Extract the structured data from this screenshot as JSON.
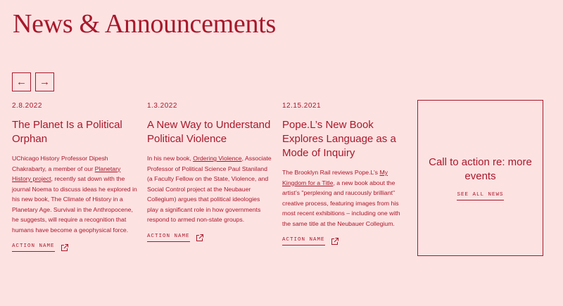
{
  "header": {
    "title": "News & Announcements"
  },
  "nav": {
    "prev": "←",
    "next": "→"
  },
  "cards": [
    {
      "date": "2.8.2022",
      "title": "The Planet Is a Political Orphan",
      "body_1": "UChicago History Professor Dipesh Chakrabarty, a member of our ",
      "link": "Planetary History project",
      "body_2": ", recently sat down with the journal Noema to discuss ideas he explored in his new book, The Climate of History in a Planetary Age. Survival in the Anthropocene, he suggests, will require a recognition that humans have become a geophysical force.",
      "action": "ACTION NAME"
    },
    {
      "date": "1.3.2022",
      "title": "A New Way to Understand Political Violence",
      "body_1": "In his new book, ",
      "link": "Ordering Violence",
      "body_2": ", Associate Professor of Political Science Paul Staniland (a Faculty Fellow on the State, Violence, and Social Control project at the Neubauer Collegium) argues that political ideologies play a significant role in how governments respond to armed non-state groups.",
      "action": "ACTION NAME"
    },
    {
      "date": "12.15.2021",
      "title": "Pope.L’s New Book Explores Language as a Mode of Inquiry",
      "body_1": "The Brooklyn Rail reviews Pope.L’s ",
      "link": "My Kingdom for a Title",
      "body_2": ", a new book about the artist’s \"perplexing and raucously brilliant\" creative process, featuring images from his most recent exhibitions – including one with the same title at the Neubauer Collegium.",
      "action": "ACTION NAME"
    }
  ],
  "cta": {
    "text": "Call to action re: more events",
    "link": "SEE ALL NEWS"
  },
  "colors": {
    "background": "#fde2e2",
    "accent": "#a8182a"
  },
  "icons": {
    "external": "external-link-icon"
  }
}
